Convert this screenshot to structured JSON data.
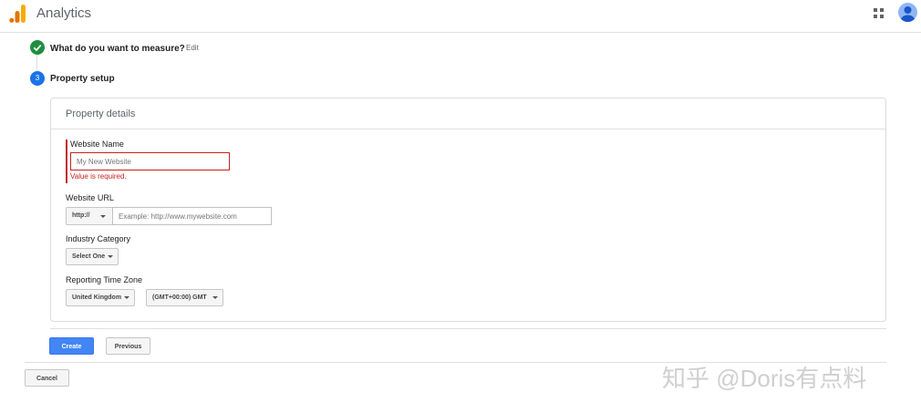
{
  "header": {
    "app_title": "Analytics",
    "logo_icon": "analytics-logo-icon",
    "apps_icon": "apps-grid-icon",
    "avatar_icon": "user-avatar-icon"
  },
  "steps": {
    "completed": {
      "label": "What do you want to measure?",
      "edit_label": "Edit",
      "icon": "check-icon"
    },
    "current": {
      "number": "3",
      "label": "Property setup"
    }
  },
  "form": {
    "title": "Property details",
    "website_name": {
      "label": "Website Name",
      "placeholder": "My New Website",
      "value": "",
      "error": "Value is required."
    },
    "website_url": {
      "label": "Website URL",
      "protocol": "http://",
      "placeholder": "Example: http://www.mywebsite.com",
      "value": ""
    },
    "industry_category": {
      "label": "Industry Category",
      "selected": "Select One"
    },
    "time_zone": {
      "label": "Reporting Time Zone",
      "country": "United Kingdom",
      "zone": "(GMT+00:00) GMT"
    }
  },
  "actions": {
    "create_label": "Create",
    "previous_label": "Previous",
    "cancel_label": "Cancel"
  },
  "watermark": "知乎 @Doris有点料",
  "colors": {
    "primary": "#4285f4",
    "error": "#c5221f",
    "success": "#1e8e3e",
    "step_active": "#1a73e8"
  }
}
